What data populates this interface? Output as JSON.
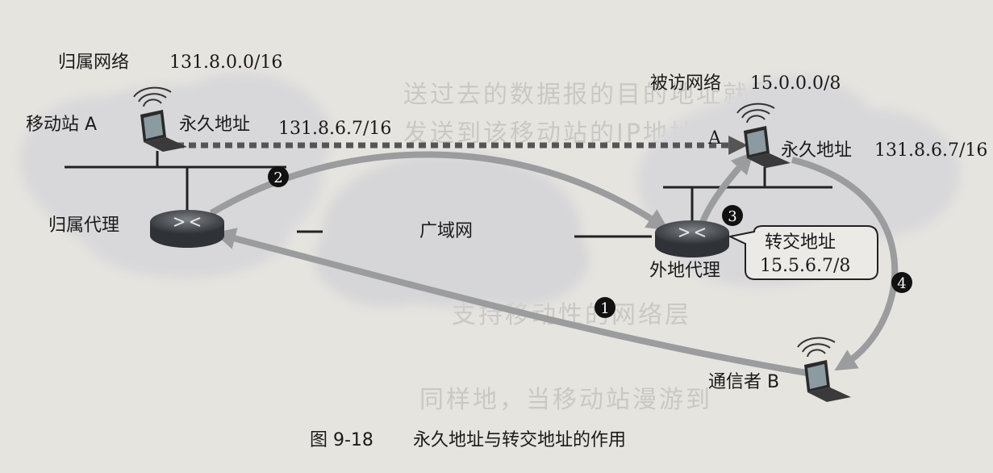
{
  "home_network": {
    "label": "归属网络",
    "address": "131.8.0.0/16"
  },
  "visited_network": {
    "label": "被访网络",
    "address": "15.0.0.0/8"
  },
  "mobile_station": {
    "label": "移动站 A",
    "perm_label": "永久地址",
    "perm_address": "131.8.6.7/16"
  },
  "visited_station": {
    "label": "A",
    "perm_label": "永久地址",
    "perm_address": "131.8.6.7/16"
  },
  "home_agent": {
    "label": "归属代理"
  },
  "foreign_agent": {
    "label": "外地代理"
  },
  "wan": {
    "label": "广域网"
  },
  "care_of": {
    "label": "转交地址",
    "address": "15.5.6.7/8"
  },
  "correspondent": {
    "label": "通信者 B"
  },
  "steps": [
    "1",
    "2",
    "3",
    "4"
  ],
  "caption": {
    "number": "图 9-18",
    "text": "永久地址与转交地址的作用"
  },
  "colors": {
    "arrow": "#9a9c9e",
    "cloud": "#d9d9da",
    "link": "#222222",
    "badge": "#111111"
  }
}
